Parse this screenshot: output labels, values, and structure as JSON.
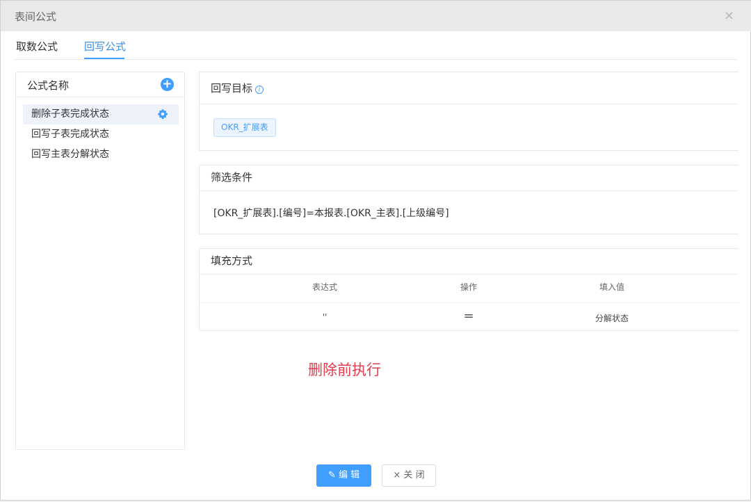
{
  "dialog": {
    "title": "表间公式",
    "close_glyph": "×"
  },
  "tabs": [
    {
      "label": "取数公式",
      "active": false
    },
    {
      "label": "回写公式",
      "active": true
    }
  ],
  "left_panel": {
    "title": "公式名称",
    "add_glyph": "+",
    "items": [
      {
        "label": "删除子表完成状态",
        "active": true
      },
      {
        "label": "回写子表完成状态",
        "active": false
      },
      {
        "label": "回写主表分解状态",
        "active": false
      }
    ]
  },
  "writeback_target": {
    "title": "回写目标",
    "info_glyph": "i",
    "tag": "OKR_扩展表"
  },
  "filter": {
    "title": "筛选条件",
    "expression": "[OKR_扩展表].[编号]=本报表.[OKR_主表].[上级编号]"
  },
  "fill": {
    "title": "填充方式",
    "columns": [
      "表达式",
      "操作",
      "填入值"
    ],
    "rows": [
      {
        "expression": "''",
        "operation": "=",
        "value": "分解状态"
      }
    ]
  },
  "note": "删除前执行",
  "footer": {
    "edit_label": "编 辑",
    "edit_icon": "✎",
    "close_label": "× 关 闭"
  },
  "colors": {
    "accent": "#409eff",
    "note": "#e63c4d"
  }
}
